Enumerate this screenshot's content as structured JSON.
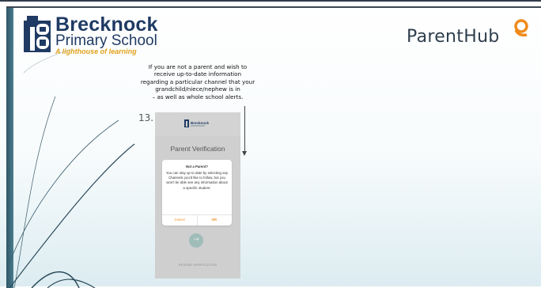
{
  "school": {
    "name_line1": "Brecknock",
    "name_line2": "Primary School",
    "tagline": "A lighthouse of learning"
  },
  "parenthub": {
    "logo_text": "ParentHub"
  },
  "instructions": {
    "lines": [
      "If you are not a parent and wish to",
      "receive up-to-date information",
      "regarding a particular channel that your",
      "grandchild/niece/nephew is in",
      "– as well as whole school alerts."
    ]
  },
  "step": {
    "number": "13."
  },
  "phone": {
    "header_logo_text": "Brecknock",
    "screen_title": "Parent Verification",
    "modal": {
      "title": "Not a Parent?",
      "body": "You can stay up to date by selecting any Channels you'd like to follow, but you won't be able see any information about a specific student.",
      "cancel_label": "Cancel",
      "ok_label": "OK"
    },
    "next_icon": "arrow-right-icon",
    "footer_text": "RESEND VERIFICATION"
  },
  "colors": {
    "accent_orange": "#f08a1c",
    "school_navy": "#1f3a63",
    "tagline_gold": "#e0a21b",
    "sidebar_teal": "#2f5565"
  }
}
